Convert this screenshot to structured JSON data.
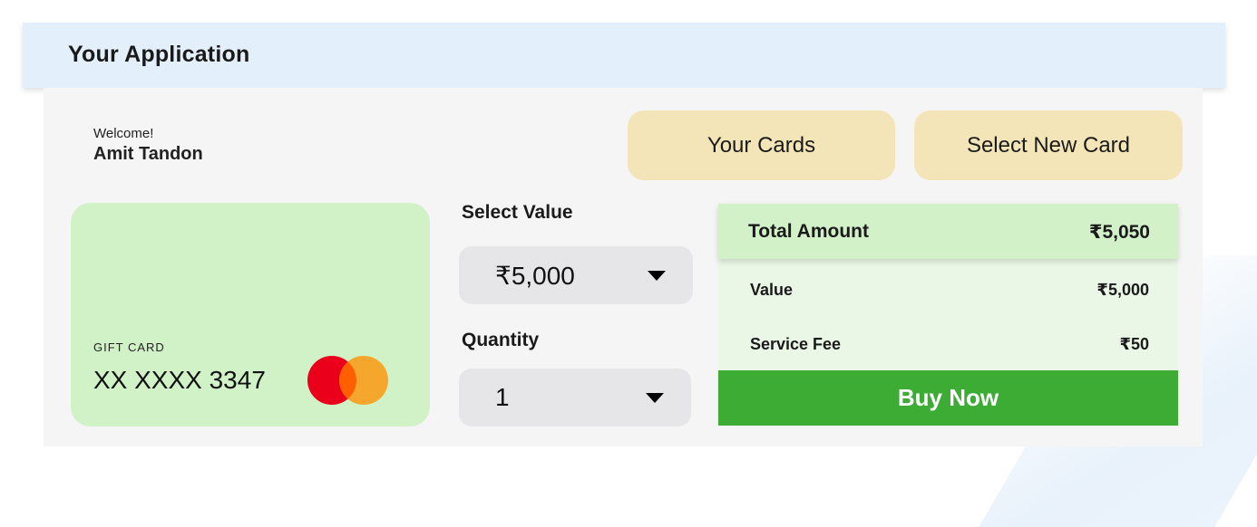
{
  "header": {
    "title": "Your Application"
  },
  "user": {
    "greeting": "Welcome!",
    "name": "Amit Tandon"
  },
  "actions": {
    "your_cards": "Your Cards",
    "select_new_card": "Select New Card"
  },
  "card": {
    "type_label": "GIFT CARD",
    "number": "XX XXXX 3347",
    "brand_icon": "mastercard-logo-icon",
    "colors": {
      "card_bg": "#d1f2c7",
      "mc_red": "#eb001b",
      "mc_orange": "#f79e1b"
    }
  },
  "form": {
    "value_label": "Select Value",
    "value_selected": "₹5,000",
    "quantity_label": "Quantity",
    "quantity_selected": "1"
  },
  "summary": {
    "total_label": "Total Amount",
    "total_value": "₹5,050",
    "value_label": "Value",
    "value_amount": "₹5,000",
    "fee_label": "Service Fee",
    "fee_amount": "₹50",
    "buy_label": "Buy Now",
    "colors": {
      "buy_bg": "#3cac35",
      "total_bg": "#d3f1c9",
      "rows_bg": "#eaf7e6"
    }
  }
}
